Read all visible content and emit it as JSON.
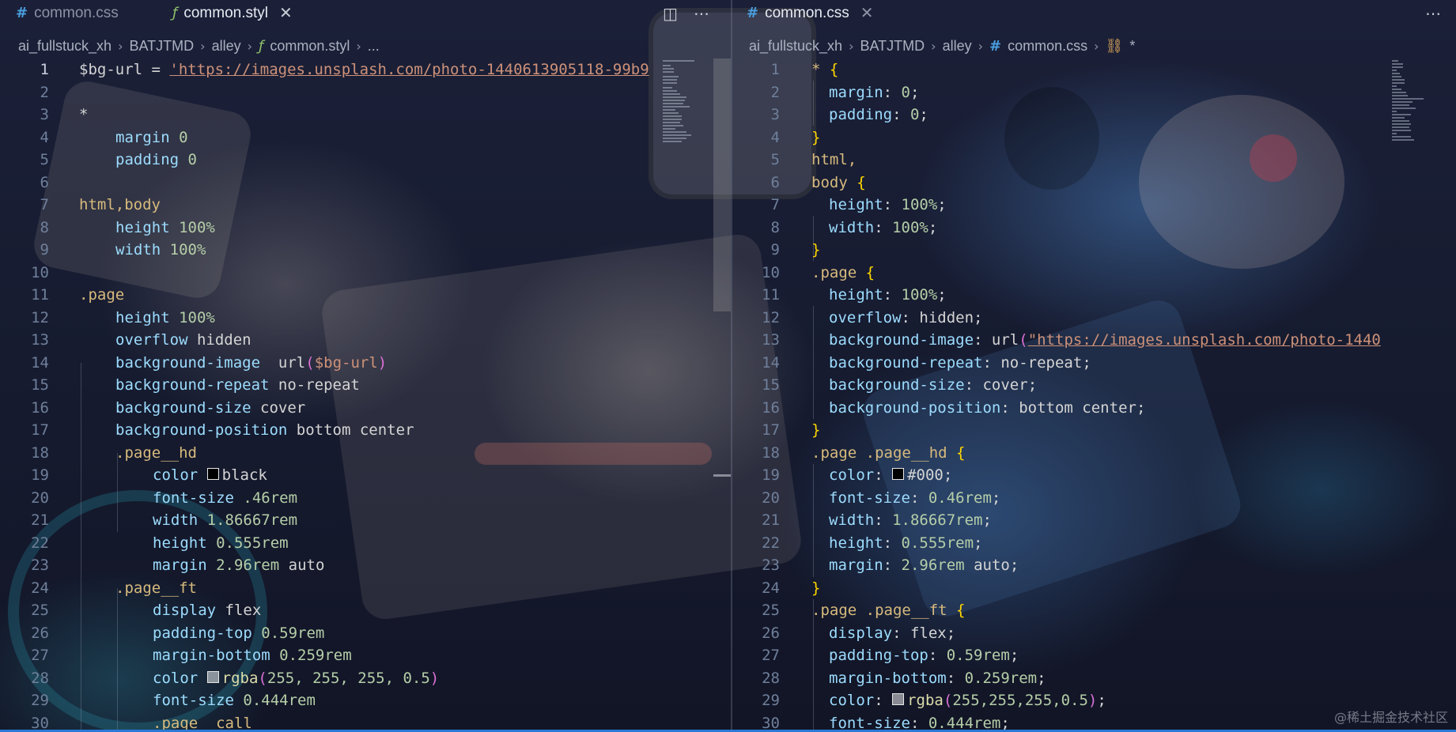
{
  "left": {
    "tabs": [
      {
        "label": "common.css",
        "icon": "css-file-icon",
        "active": false
      },
      {
        "label": "common.styl",
        "icon": "stylus-file-icon",
        "active": true
      }
    ],
    "breadcrumb": [
      "ai_fullstuck_xh",
      "BATJTMD",
      "alley",
      "common.styl",
      "..."
    ],
    "lines": [
      "1",
      "2",
      "3",
      "4",
      "5",
      "6",
      "7",
      "8",
      "9",
      "10",
      "11",
      "12",
      "13",
      "14",
      "15",
      "16",
      "17",
      "18",
      "19",
      "20",
      "21",
      "22",
      "23",
      "24",
      "25",
      "26",
      "27",
      "28",
      "29",
      "30"
    ],
    "code": {
      "l1_var": "$bg-url",
      "l1_eq": " = ",
      "l1_str": "'https://images.unsplash.com/photo-1440613905118-99b9",
      "l3": "*",
      "l4_p": "margin",
      "l4_v": "0",
      "l5_p": "padding",
      "l5_v": "0",
      "l7": "html,body",
      "l8_p": "height",
      "l8_v": "100%",
      "l9_p": "width",
      "l9_v": "100%",
      "l11": ".page",
      "l12_p": "height",
      "l12_v": "100%",
      "l13_p": "overflow",
      "l13_v": "hidden",
      "l14_p": "background-image",
      "l14_fn": "url",
      "l14_op": "(",
      "l14_var": "$bg-url",
      "l14_cp": ")",
      "l15_p": "background-repeat",
      "l15_v": "no-repeat",
      "l16_p": "background-size",
      "l16_v": "cover",
      "l17_p": "background-position",
      "l17_v": "bottom center",
      "l18": ".page__hd",
      "l19_p": "color",
      "l19_v": "black",
      "l20_p": "font-size",
      "l20_v": ".46rem",
      "l21_p": "width",
      "l21_v": "1.86667rem",
      "l22_p": "height",
      "l22_v": "0.555rem",
      "l23_p": "margin",
      "l23_v1": "2.96rem",
      "l23_v2": "auto",
      "l24": ".page__ft",
      "l25_p": "display",
      "l25_v": "flex",
      "l26_p": "padding-top",
      "l26_v": "0.59rem",
      "l27_p": "margin-bottom",
      "l27_v": "0.259rem",
      "l28_p": "color",
      "l28_fn": "rgba",
      "l28_args": "255, 255, 255, 0.5",
      "l29_p": "font-size",
      "l29_v": "0.444rem",
      "l30": ".page__call"
    }
  },
  "right": {
    "tabs": [
      {
        "label": "common.css",
        "icon": "css-file-icon",
        "active": true
      }
    ],
    "breadcrumb": [
      "ai_fullstuck_xh",
      "BATJTMD",
      "alley",
      "common.css",
      "*"
    ],
    "lines": [
      "1",
      "2",
      "3",
      "4",
      "5",
      "6",
      "7",
      "8",
      "9",
      "10",
      "11",
      "12",
      "13",
      "14",
      "15",
      "16",
      "17",
      "18",
      "19",
      "20",
      "21",
      "22",
      "23",
      "24",
      "25",
      "26",
      "27",
      "28",
      "29",
      "30"
    ],
    "code": {
      "l1_sel": "*",
      "l1_b": "{",
      "l2_p": "margin",
      "l2_v": "0",
      "l3_p": "padding",
      "l3_v": "0",
      "l4_b": "}",
      "l5": "html,",
      "l6_sel": "body",
      "l6_b": "{",
      "l7_p": "height",
      "l7_v": "100%",
      "l8_p": "width",
      "l8_v": "100%",
      "l9_b": "}",
      "l10_sel": ".page",
      "l10_b": "{",
      "l11_p": "height",
      "l11_v": "100%",
      "l12_p": "overflow",
      "l12_v": "hidden",
      "l13_p": "background-image",
      "l13_fn": "url",
      "l13_op": "(",
      "l13_str": "\"https://images.unsplash.com/photo-1440",
      "l14_p": "background-repeat",
      "l14_v": "no-repeat",
      "l15_p": "background-size",
      "l15_v": "cover",
      "l16_p": "background-position",
      "l16_v": "bottom center",
      "l17_b": "}",
      "l18_sel": ".page .page__hd",
      "l18_b": "{",
      "l19_p": "color",
      "l19_v": "#000",
      "l20_p": "font-size",
      "l20_v": "0.46rem",
      "l21_p": "width",
      "l21_v": "1.86667rem",
      "l22_p": "height",
      "l22_v": "0.555rem",
      "l23_p": "margin",
      "l23_v1": "2.96rem",
      "l23_v2": "auto",
      "l24_b": "}",
      "l25_sel": ".page .page__ft",
      "l25_b": "{",
      "l26_p": "display",
      "l26_v": "flex",
      "l27_p": "padding-top",
      "l27_v": "0.59rem",
      "l28_p": "margin-bottom",
      "l28_v": "0.259rem",
      "l29_p": "color",
      "l29_fn": "rgba",
      "l29_args": "255,255,255,0.5",
      "l30_p": "font-size",
      "l30_v": "0.444rem"
    }
  },
  "punct": {
    "colon": ": ",
    "semi": ";",
    "sp": " ",
    "comma": ", ",
    "open_paren": "(",
    "close_paren": ")"
  },
  "watermark": "@稀土掘金技术社区",
  "colors": {
    "selector": "#d7ba7d",
    "property": "#9cdcfe",
    "number": "#b5cea8",
    "string": "#ce9178",
    "brace": "#ffd700",
    "function": "#dcdcaa",
    "paren": "#da70d6",
    "accent": "#2b79d6"
  },
  "icons": {
    "split_editor": "split-editor-icon",
    "more_actions": "more-actions-icon",
    "close": "close-icon"
  }
}
